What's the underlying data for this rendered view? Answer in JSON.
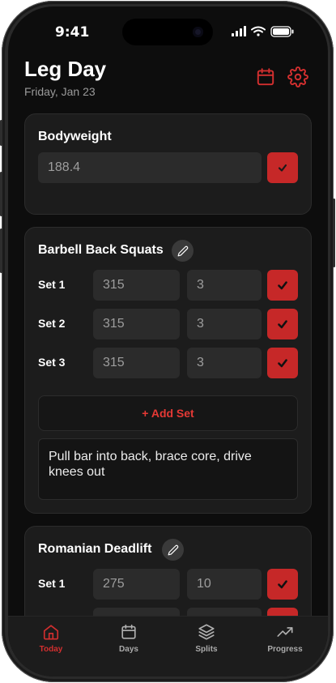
{
  "status_bar": {
    "time": "9:41"
  },
  "header": {
    "title": "Leg Day",
    "date": "Friday, Jan 23"
  },
  "bodyweight": {
    "title": "Bodyweight",
    "value": "188.4"
  },
  "exercises": [
    {
      "name": "Barbell Back Squats",
      "sets": [
        {
          "label": "Set 1",
          "weight": "315",
          "reps": "3"
        },
        {
          "label": "Set 2",
          "weight": "315",
          "reps": "3"
        },
        {
          "label": "Set 3",
          "weight": "315",
          "reps": "3"
        }
      ],
      "add_set_label": "+ Add Set",
      "notes": "Pull bar into back, brace core, drive knees out"
    },
    {
      "name": "Romanian Deadlift",
      "sets": [
        {
          "label": "Set 1",
          "weight": "275",
          "reps": "10"
        }
      ]
    }
  ],
  "tabs": [
    {
      "label": "Today",
      "icon": "home-icon",
      "active": true
    },
    {
      "label": "Days",
      "icon": "calendar-icon",
      "active": false
    },
    {
      "label": "Splits",
      "icon": "layers-icon",
      "active": false
    },
    {
      "label": "Progress",
      "icon": "trending-up-icon",
      "active": false
    }
  ],
  "colors": {
    "accent": "#c62828",
    "background": "#0d0d0d",
    "card": "#1c1c1c",
    "input": "#2b2b2b"
  }
}
